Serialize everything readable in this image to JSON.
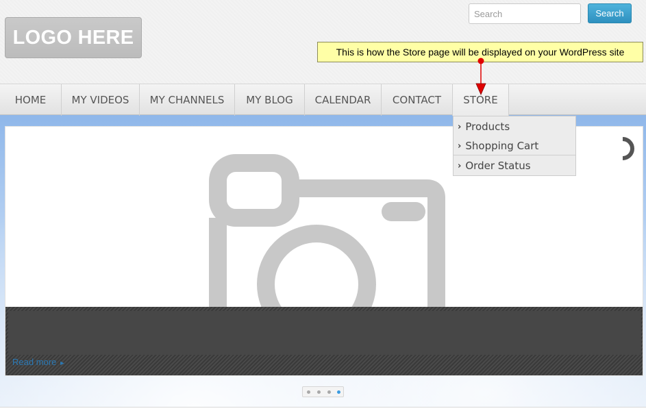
{
  "header": {
    "logo_text": "LOGO HERE",
    "search": {
      "placeholder": "Search",
      "value": "",
      "button_label": "Search"
    }
  },
  "annotation": {
    "text": "This is how the Store page will be displayed on your WordPress site",
    "background_color": "#ffffa6",
    "arrow_color": "#e00000"
  },
  "nav": {
    "items": [
      {
        "label": "HOME"
      },
      {
        "label": "MY VIDEOS"
      },
      {
        "label": "MY CHANNELS"
      },
      {
        "label": "MY BLOG"
      },
      {
        "label": "CALENDAR"
      },
      {
        "label": "CONTACT"
      },
      {
        "label": "STORE",
        "active": true
      }
    ],
    "store_dropdown": [
      {
        "label": "Products",
        "icon": "chevron-right-icon"
      },
      {
        "label": "Shopping Cart",
        "icon": "chevron-right-icon"
      },
      {
        "label": "Order Status",
        "icon": "chevron-right-icon"
      }
    ]
  },
  "slider": {
    "image_placeholder_icon": "camera-icon",
    "loading_icon": "spinner-icon",
    "read_more": "Read more",
    "pager": {
      "count": 4,
      "active_index": 3
    },
    "accent_color": "#3b9be0"
  }
}
